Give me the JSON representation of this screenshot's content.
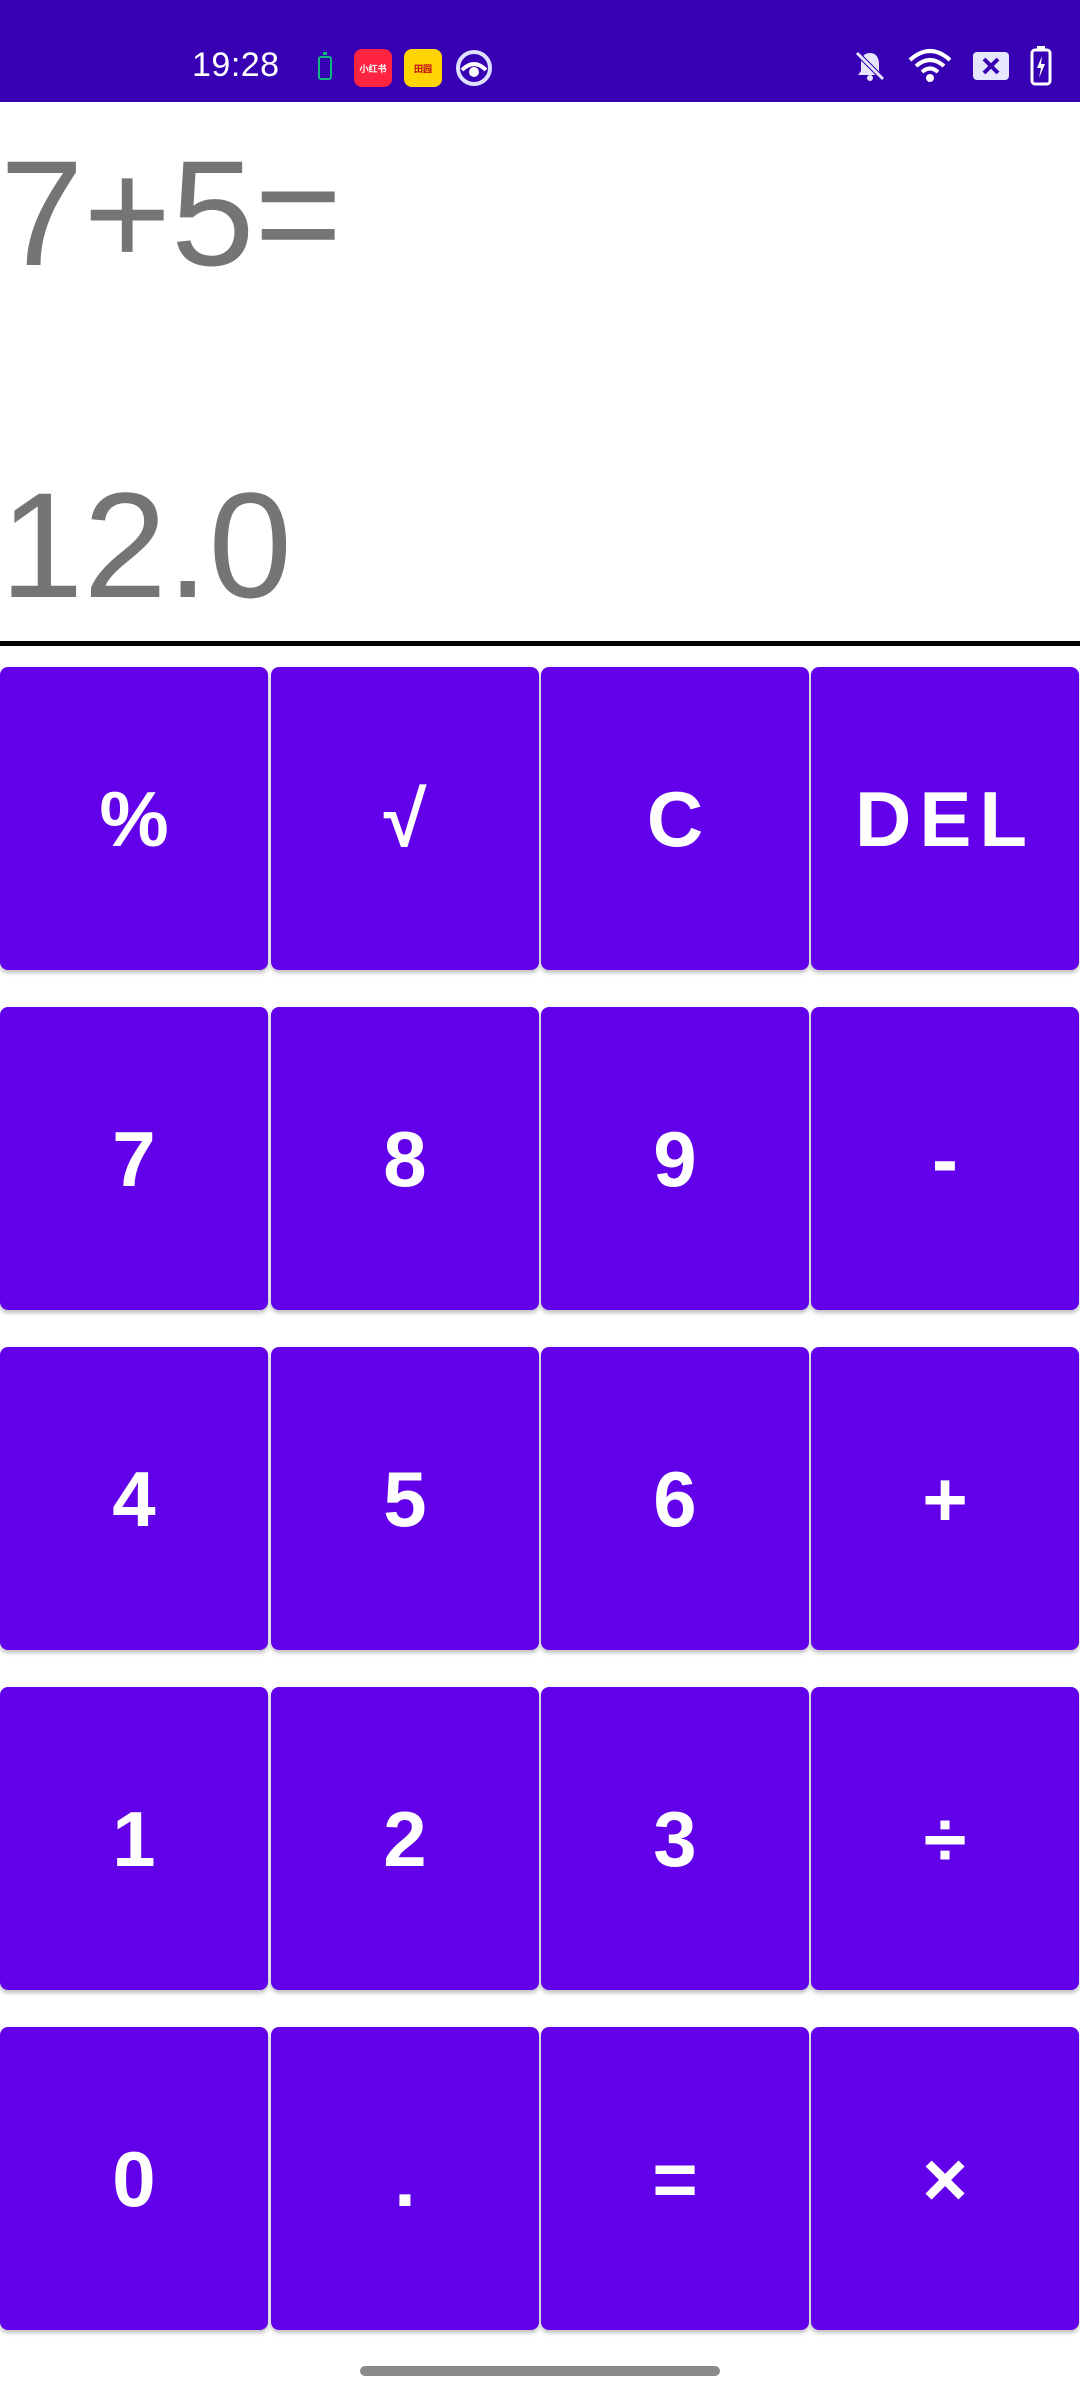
{
  "status_bar": {
    "time": "19:28",
    "background_color": "#3700b3",
    "app_icon_1_text": "小红书",
    "app_icon_2_text": "田园",
    "left_icons": [
      "battery-saver-icon",
      "xiaohongshu-app-icon",
      "game-app-icon",
      "cloud-app-icon"
    ],
    "right_icons": [
      "bell-muted-icon",
      "wifi-icon",
      "sim-x-icon",
      "battery-charging-icon"
    ]
  },
  "display": {
    "expression": "7+5=",
    "result": "12.0",
    "text_color": "#757575"
  },
  "keypad": {
    "key_color": "#6200ea",
    "rows": [
      [
        "%",
        "√",
        "C",
        "DEL"
      ],
      [
        "7",
        "8",
        "9",
        "-"
      ],
      [
        "4",
        "5",
        "6",
        "+"
      ],
      [
        "1",
        "2",
        "3",
        "÷"
      ],
      [
        "0",
        ".",
        "=",
        "×"
      ]
    ]
  }
}
